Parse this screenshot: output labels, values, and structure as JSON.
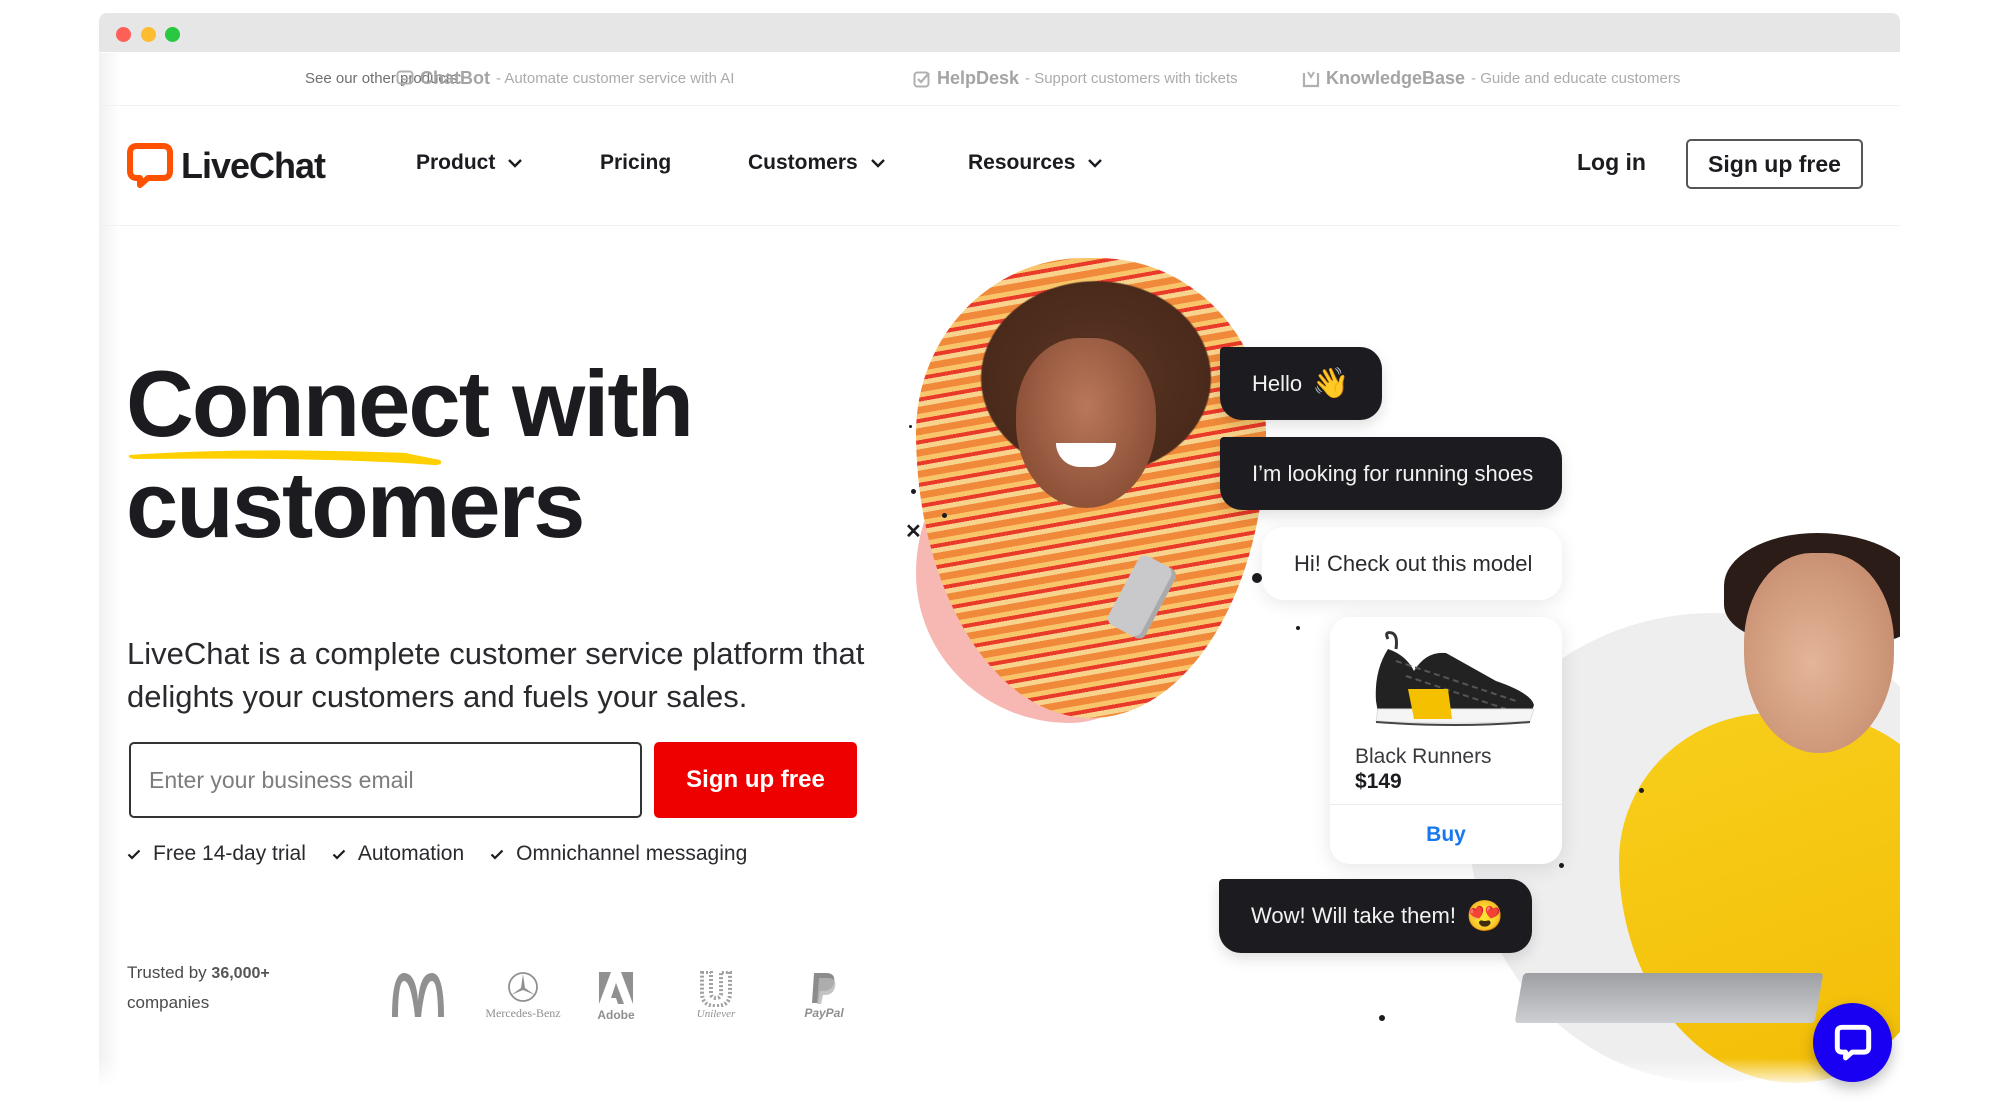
{
  "window": {
    "controls": [
      "close",
      "minimize",
      "maximize"
    ]
  },
  "products_bar": {
    "lead": "See our other products:",
    "items": [
      {
        "icon": "chatbot-icon",
        "name": "ChatBot",
        "desc": "- Automate customer service with AI"
      },
      {
        "icon": "helpdesk-icon",
        "name": "HelpDesk",
        "desc": "- Support customers with tickets"
      },
      {
        "icon": "knowledgebase-icon",
        "name": "KnowledgeBase",
        "desc": "- Guide and educate customers"
      }
    ]
  },
  "header": {
    "logo": "LiveChat",
    "nav": [
      {
        "label": "Product",
        "has_dropdown": true
      },
      {
        "label": "Pricing",
        "has_dropdown": false
      },
      {
        "label": "Customers",
        "has_dropdown": true
      },
      {
        "label": "Resources",
        "has_dropdown": true
      }
    ],
    "login": "Log in",
    "signup": "Sign up free"
  },
  "hero": {
    "headline_line1": "Connect with",
    "headline_line2": "customers",
    "subtitle": "LiveChat is a complete customer service platform that delights your customers and fuels your sales.",
    "email_placeholder": "Enter your business email",
    "email_value": "",
    "cta": "Sign up free",
    "features": [
      "Free 14-day trial",
      "Automation",
      "Omnichannel messaging"
    ],
    "trusted_prefix": "Trusted by",
    "trusted_count": "36,000+",
    "trusted_suffix": "companies",
    "brands": [
      "McDonald's",
      "Mercedes-Benz",
      "Adobe",
      "Unilever",
      "PayPal"
    ]
  },
  "chat_demo": {
    "messages": [
      {
        "from": "customer",
        "text": "Hello",
        "emoji": "👋"
      },
      {
        "from": "customer",
        "text": "I’m looking for running shoes",
        "emoji": ""
      },
      {
        "from": "agent",
        "text": "Hi! Check out this model",
        "emoji": ""
      },
      {
        "from": "customer",
        "text": "Wow! Will take them!",
        "emoji": "😍"
      }
    ],
    "product_card": {
      "name": "Black Runners",
      "price": "$149",
      "action": "Buy"
    }
  },
  "colors": {
    "brand_orange": "#ff5100",
    "cta_red": "#ee0000",
    "highlight_yellow": "#ffd000",
    "chat_widget_blue": "#1a00f2",
    "link_blue": "#1878ee",
    "dark_bubble": "#1b1b20"
  },
  "chat_widget": {
    "icon": "chat-bubble-icon"
  }
}
